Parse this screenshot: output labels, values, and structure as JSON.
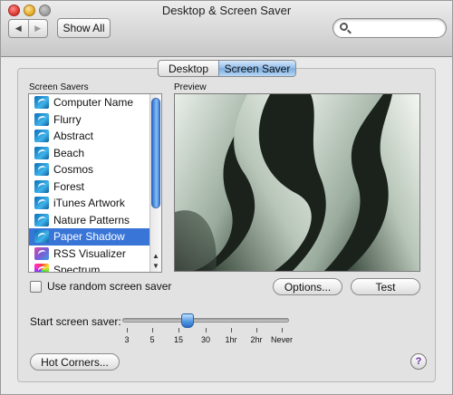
{
  "window": {
    "title": "Desktop & Screen Saver"
  },
  "toolbar": {
    "back_icon": "chevron-left-icon",
    "forward_icon": "chevron-right-icon",
    "back_glyph": "◀",
    "forward_glyph": "▶",
    "show_all_label": "Show All",
    "search_placeholder": "",
    "search_icon": "magnifier-icon"
  },
  "tabs": [
    {
      "label": "Desktop",
      "selected": false
    },
    {
      "label": "Screen Saver",
      "selected": true
    }
  ],
  "screen_savers": {
    "heading": "Screen Savers",
    "items": [
      {
        "label": "Computer Name",
        "selected": false
      },
      {
        "label": "Flurry",
        "selected": false
      },
      {
        "label": "Abstract",
        "selected": false
      },
      {
        "label": "Beach",
        "selected": false
      },
      {
        "label": "Cosmos",
        "selected": false
      },
      {
        "label": "Forest",
        "selected": false
      },
      {
        "label": "iTunes Artwork",
        "selected": false
      },
      {
        "label": "Nature Patterns",
        "selected": false
      },
      {
        "label": "Paper Shadow",
        "selected": true
      },
      {
        "label": "RSS Visualizer",
        "selected": false
      },
      {
        "label": "Spectrum",
        "selected": false
      }
    ],
    "scroll_up_glyph": "▲",
    "scroll_down_glyph": "▼"
  },
  "preview": {
    "heading": "Preview"
  },
  "random": {
    "label": "Use random screen saver",
    "checked": false
  },
  "buttons": {
    "options_label": "Options...",
    "test_label": "Test",
    "hot_corners_label": "Hot Corners..."
  },
  "start": {
    "label": "Start screen saver:",
    "ticks": [
      "3",
      "5",
      "15",
      "30",
      "1hr",
      "2hr",
      "Never"
    ],
    "selected_tick": "15"
  },
  "help": {
    "glyph": "?",
    "icon": "help-icon"
  },
  "colors": {
    "selection": "#3875d7",
    "tab_selected": "#8fbbe8"
  }
}
